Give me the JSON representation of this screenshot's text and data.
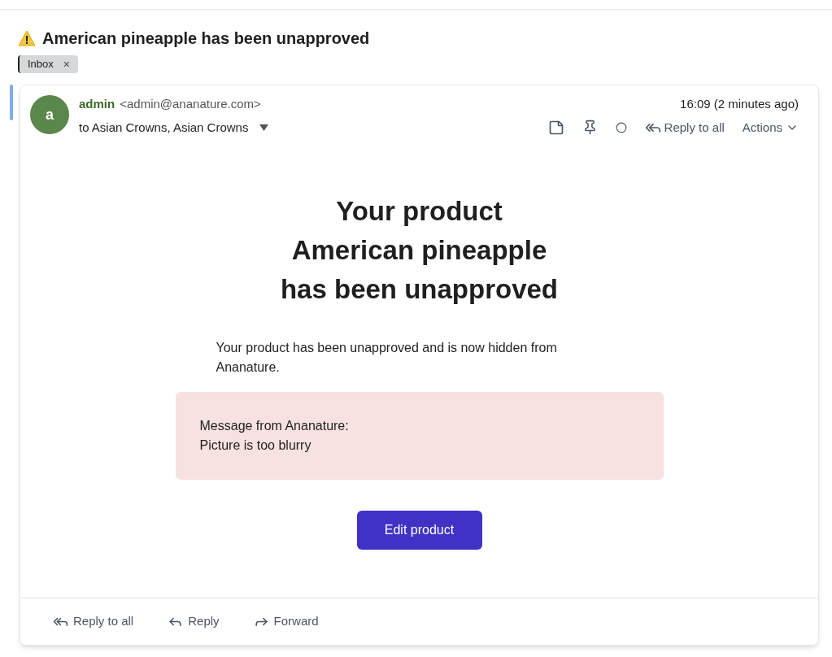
{
  "subject": "American pineapple has been unapproved",
  "labels": [
    {
      "text": "Inbox",
      "close": "×"
    }
  ],
  "message": {
    "avatar": "a",
    "sender_name": "admin",
    "sender_email": "<admin@ananature.com>",
    "recipients": "to Asian Crowns, Asian Crowns",
    "time": "16:09 (2 minutes ago)",
    "reply_all": "Reply to all",
    "actions": "Actions",
    "heading": [
      "Your product",
      "American pineapple",
      "has been unapproved"
    ],
    "body": "Your product has been unapproved and is now hidden from Ananature.",
    "notice": [
      "Message from Ananature:",
      "Picture is too blurry"
    ],
    "cta": "Edit product"
  },
  "footer_buttons": [
    {
      "kind": "reply-all",
      "label": "Reply to all"
    },
    {
      "kind": "reply",
      "label": "Reply"
    },
    {
      "kind": "forward",
      "label": "Forward"
    }
  ]
}
